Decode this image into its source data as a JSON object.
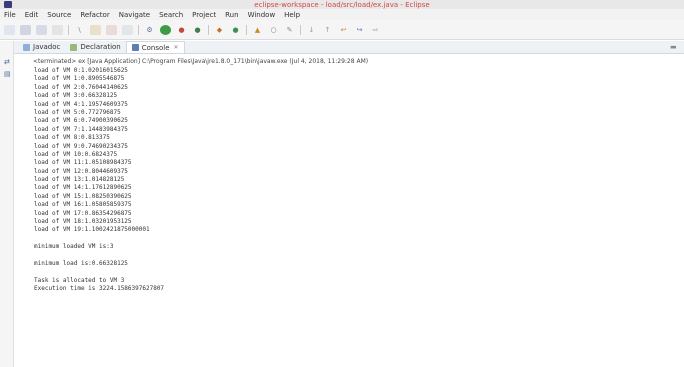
{
  "window": {
    "title": "eclipse-workspace - load/src/load/ex.java - Eclipse"
  },
  "menu": {
    "items": [
      "File",
      "Edit",
      "Source",
      "Refactor",
      "Navigate",
      "Search",
      "Project",
      "Run",
      "Window",
      "Help"
    ]
  },
  "tabs": [
    {
      "label": "Javadoc",
      "icon": "javadoc-icon"
    },
    {
      "label": "Declaration",
      "icon": "declaration-icon"
    },
    {
      "label": "Console",
      "icon": "console-icon",
      "close": "✕"
    }
  ],
  "console": {
    "header": "<terminated> ex [Java Application] C:\\Program Files\\Java\\jre1.8.0_171\\bin\\javaw.exe (Jul 4, 2018, 11:29:28 AM)",
    "lines": [
      "load of VM 0:1.02016015625",
      "load of VM 1:0.8905546875",
      "load of VM 2:0.76044140625",
      "load of VM 3:0.66328125",
      "load of VM 4:1.19574609375",
      "load of VM 5:0.772796875",
      "load of VM 6:0.74900390625",
      "load of VM 7:1.14483984375",
      "load of VM 8:0.813375",
      "load of VM 9:0.74690234375",
      "load of VM 10:0.6824375",
      "load of VM 11:1.05108984375",
      "load of VM 12:0.8044609375",
      "load of VM 13:1.014828125",
      "load of VM 14:1.17612890625",
      "load of VM 15:1.08250390625",
      "load of VM 16:1.05805859375",
      "load of VM 17:0.86354296875",
      "load of VM 18:1.03201953125",
      "load of VM 19:1.1002421875000001",
      "",
      "minimum loaded VM is:3",
      "",
      "minimum load is:0.66328125",
      "",
      "Task is allocated to VM 3",
      "Execution time is 3224.1586397627807"
    ]
  }
}
